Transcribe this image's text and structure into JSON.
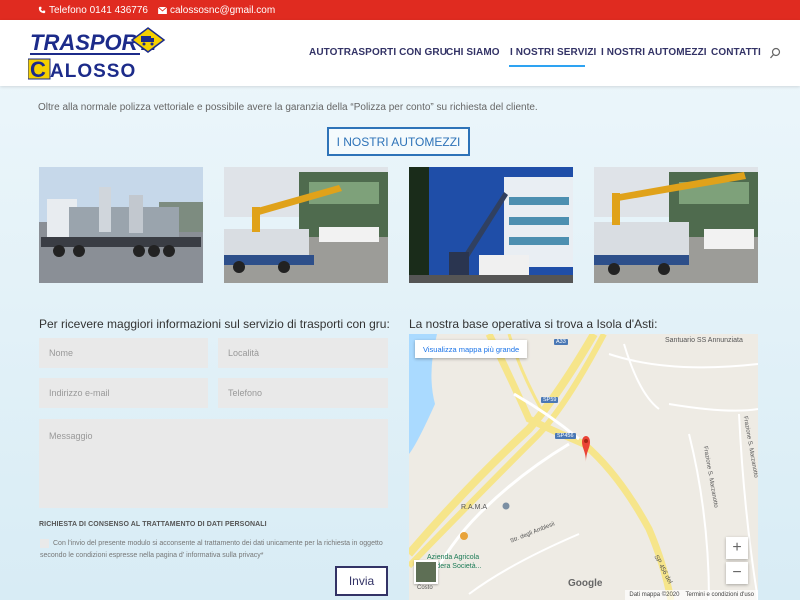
{
  "topbar": {
    "phone": "Telefono 0141 436776",
    "email": "calossosnc@gmail.com",
    "phone_icon": "phone-icon",
    "email_icon": "envelope-icon"
  },
  "logo": {
    "line1": "TRASPORTI",
    "line2": "ALOSSO",
    "initial": "C"
  },
  "nav": {
    "items": [
      {
        "label": "AUTOTRASPORTI CON GRU"
      },
      {
        "label": "CHI SIAMO"
      },
      {
        "label": "I NOSTRI SERVIZI",
        "active": true
      },
      {
        "label": "I NOSTRI AUTOMEZZI"
      },
      {
        "label": "CONTATTI"
      }
    ],
    "search_icon": "search-icon"
  },
  "content": {
    "intro": "Oltre alla normale polizza vettoriale e possibile avere la garanzia della “Polizza per conto” su richiesta del cliente.",
    "automezzi_button": "I NOSTRI AUTOMEZZI"
  },
  "form": {
    "title": "Per ricevere maggiori informazioni sul servizio di trasporti con gru:",
    "fields": {
      "nome": "Nome",
      "localita": "Località",
      "email": "Indirizzo e-mail",
      "telefono": "Telefono",
      "messaggio": "Messaggio"
    },
    "consent_title": "RICHIESTA DI CONSENSO AL TRATTAMENTO DI DATI PERSONALI",
    "consent_text": "Con l'invio del presente modulo si acconsente al trattamento dei dati unicamente per la richiesta in oggetto secondo le condizioni espresse nella pagina d' informativa sulla privacy*",
    "submit": "Invia"
  },
  "map": {
    "title": "La nostra base operativa si trova a Isola d'Asti:",
    "view_larger": "Visualizza mappa più grande",
    "labels": {
      "santuario": "Santuario SS Annunziata",
      "rama": "R.A.M.A",
      "strada": "Str. degli Amblesii",
      "azienda1": "Azienda Agricola",
      "azienda2": "Gadera Società...",
      "frazione1": "Frazione S. Marzanotto",
      "frazione2": "Frazione S. Marzanotto",
      "sp456": "SP 456 del",
      "costo": "Costo",
      "google": "Google"
    },
    "badges": {
      "a33": "A33",
      "sp59": "SP59",
      "sp456": "SP456"
    },
    "zoom_in": "+",
    "zoom_out": "−",
    "footer": {
      "data": "Dati mappa ©2020",
      "terms": "Termini e condizioni d'uso"
    }
  }
}
